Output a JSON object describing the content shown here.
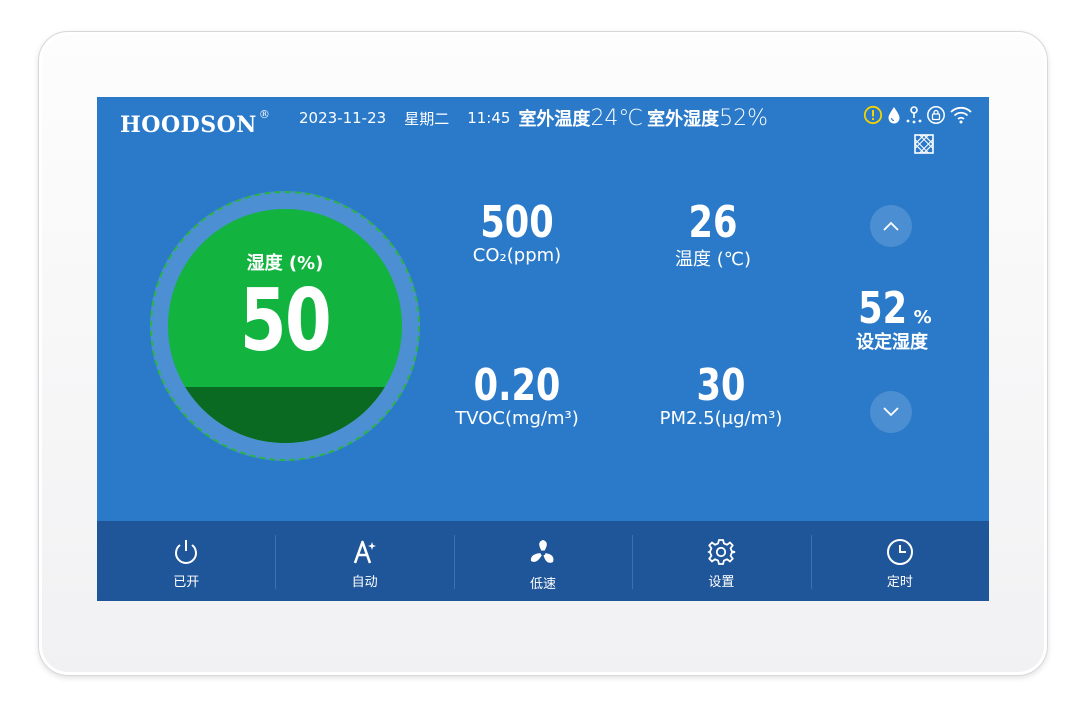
{
  "brand": {
    "name": "HOODSON",
    "reg": "®"
  },
  "status_bar": {
    "date": "2023-11-23",
    "weekday": "星期二",
    "time": "11:45",
    "outdoor_temp_label": "室外温度",
    "outdoor_temp_value": "24℃",
    "outdoor_humidity_label": "室外湿度",
    "outdoor_humidity_value": "52%",
    "icons": [
      "alert-icon",
      "water-drop-icon",
      "sprinkler-icon",
      "lock-icon",
      "wifi-icon",
      "filter-icon"
    ]
  },
  "dial": {
    "label": "湿度 (%)",
    "value": "50",
    "fill_fraction": 0.24,
    "color": "#12b33f",
    "fill_color": "#0a6a22"
  },
  "metrics": {
    "co2": {
      "value": "500",
      "unit": "CO₂(ppm)"
    },
    "temperature": {
      "value": "26",
      "unit": "温度 (℃)"
    },
    "tvoc": {
      "value": "0.20",
      "unit": "TVOC(mg/m³)"
    },
    "pm25": {
      "value": "30",
      "unit": "PM2.5(μg/m³)"
    }
  },
  "setpoint": {
    "value": "52",
    "unit": "%",
    "label": "设定湿度"
  },
  "bottom_nav": [
    {
      "label": "已开",
      "icon": "power-icon"
    },
    {
      "label": "自动",
      "icon": "auto-mode-icon"
    },
    {
      "label": "低速",
      "icon": "fan-icon"
    },
    {
      "label": "设置",
      "icon": "gear-icon"
    },
    {
      "label": "定时",
      "icon": "clock-icon"
    }
  ],
  "colors": {
    "screen_bg": "#2a7ac9",
    "bottom_bar": "#1f5599",
    "alert": "#f5d300"
  }
}
